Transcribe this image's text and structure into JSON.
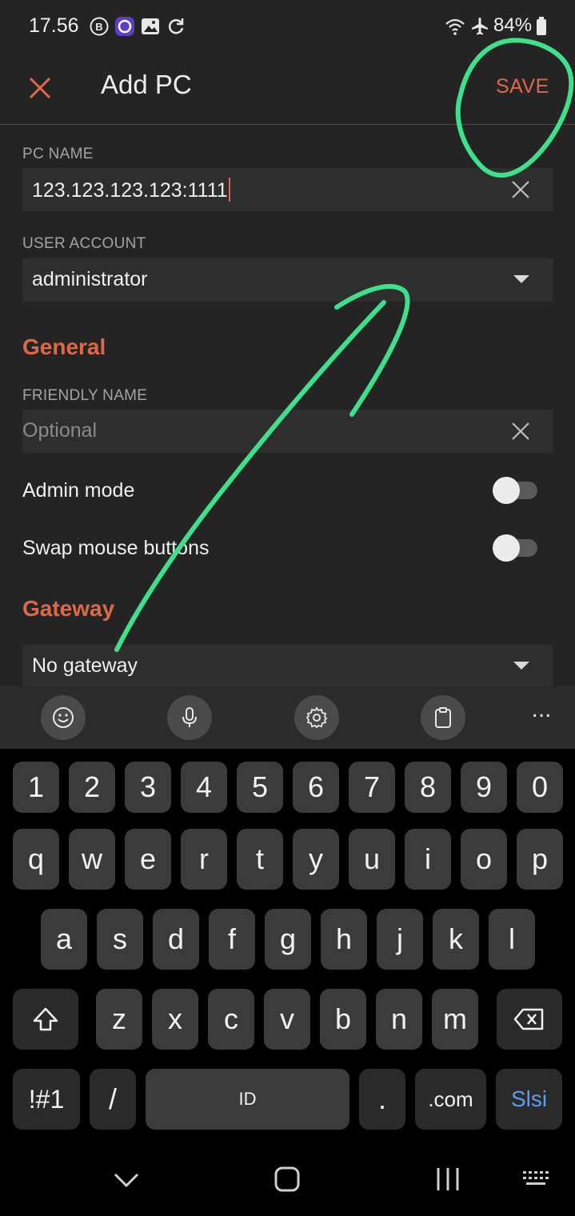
{
  "status_bar": {
    "time": "17.56",
    "battery": "84%",
    "icons": [
      "b-icon",
      "circle-app-icon",
      "gallery-icon",
      "sync-icon",
      "wifi-icon",
      "airplane-icon",
      "battery-icon"
    ]
  },
  "app_bar": {
    "title": "Add PC",
    "save_label": "SAVE",
    "close_icon": "close-icon"
  },
  "form": {
    "pc_name_label": "PC NAME",
    "pc_name_value": "123.123.123.123:1111",
    "user_account_label": "USER ACCOUNT",
    "user_account_value": "administrator",
    "general_title": "General",
    "friendly_name_label": "FRIENDLY NAME",
    "friendly_name_placeholder": "Optional",
    "admin_mode_label": "Admin mode",
    "admin_mode_on": false,
    "swap_mouse_label": "Swap mouse buttons",
    "swap_mouse_on": false,
    "gateway_title": "Gateway",
    "gateway_value": "No gateway"
  },
  "keyboard": {
    "toolbar": [
      "emoji-icon",
      "microphone-icon",
      "settings-icon",
      "clipboard-icon",
      "more-icon"
    ],
    "more_label": "...",
    "row_numbers": [
      "1",
      "2",
      "3",
      "4",
      "5",
      "6",
      "7",
      "8",
      "9",
      "0"
    ],
    "row_q": [
      "q",
      "w",
      "e",
      "r",
      "t",
      "y",
      "u",
      "i",
      "o",
      "p"
    ],
    "row_a": [
      "a",
      "s",
      "d",
      "f",
      "g",
      "h",
      "j",
      "k",
      "l"
    ],
    "row_z": [
      "z",
      "x",
      "c",
      "v",
      "b",
      "n",
      "m"
    ],
    "symbols_label": "!#1",
    "slash_label": "/",
    "space_label": "ID",
    "dot_label": ".",
    "dotcom_label": ".com",
    "action_label": "Slsi",
    "action_color": "#5b9cf0"
  },
  "nav_bar": {
    "icons": [
      "nav-back-icon",
      "nav-home-icon",
      "nav-recents-icon",
      "keyboard-switch-icon"
    ]
  },
  "annotation": {
    "color": "#3ee08a",
    "shapes": [
      "circle-around-save",
      "arrow-to-save"
    ]
  }
}
